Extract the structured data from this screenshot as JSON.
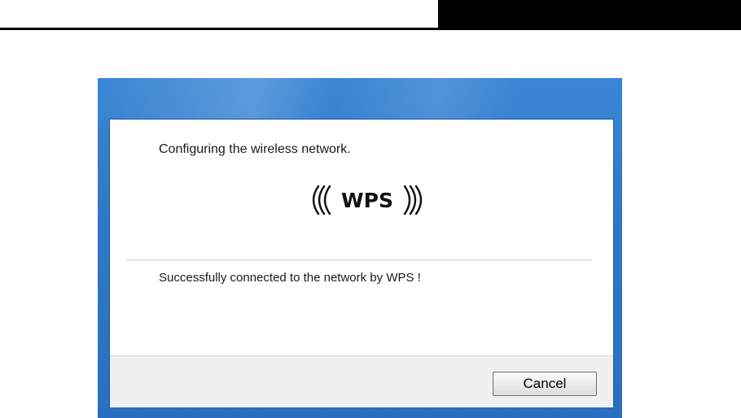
{
  "dialog": {
    "configuring_text": "Configuring the wireless network.",
    "logo_text": "WPS",
    "status_text": "Successfully connected to the network by WPS !",
    "cancel_label": "Cancel"
  },
  "colors": {
    "frame_blue": "#2f78c9",
    "client_bg": "#ffffff",
    "footer_bg": "#f0f0f0"
  },
  "icons": {
    "logo": "wps-logo-icon"
  }
}
